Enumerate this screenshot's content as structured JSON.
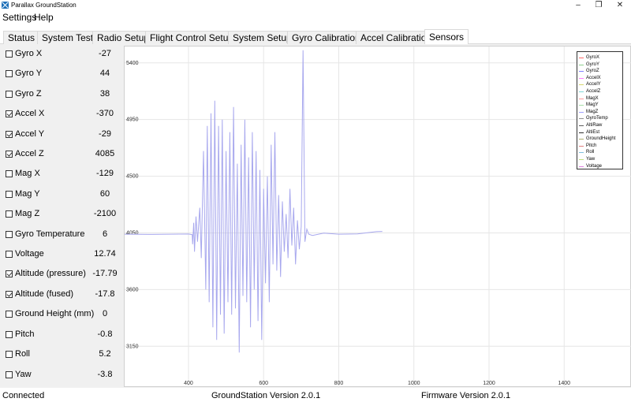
{
  "window": {
    "title": "Parallax GroundStation",
    "minimize": "–",
    "maximize": "❐",
    "close": "✕"
  },
  "menu": {
    "items": [
      "Settings",
      "Help"
    ]
  },
  "tabs": [
    {
      "label": "Status",
      "active": false
    },
    {
      "label": "System Test",
      "active": false
    },
    {
      "label": "Radio Setup",
      "active": false
    },
    {
      "label": "Flight Control Setup",
      "active": false
    },
    {
      "label": "System Setup",
      "active": false
    },
    {
      "label": "Gyro Calibration",
      "active": false
    },
    {
      "label": "Accel Calibration",
      "active": false
    },
    {
      "label": "Sensors",
      "active": true
    }
  ],
  "sensors": [
    {
      "label": "Gyro X",
      "value": "-27",
      "checked": false
    },
    {
      "label": "Gyro Y",
      "value": "44",
      "checked": false
    },
    {
      "label": "Gyro Z",
      "value": "38",
      "checked": false
    },
    {
      "label": "Accel X",
      "value": "-370",
      "checked": true
    },
    {
      "label": "Accel Y",
      "value": "-29",
      "checked": true
    },
    {
      "label": "Accel Z",
      "value": "4085",
      "checked": true
    },
    {
      "label": "Mag X",
      "value": "-129",
      "checked": false
    },
    {
      "label": "Mag Y",
      "value": "60",
      "checked": false
    },
    {
      "label": "Mag Z",
      "value": "-2100",
      "checked": false
    },
    {
      "label": "Gyro Temperature",
      "value": "6",
      "checked": false
    },
    {
      "label": "Voltage",
      "value": "12.74",
      "checked": false
    },
    {
      "label": "Altitude (pressure)",
      "value": "-17.79",
      "checked": true
    },
    {
      "label": "Altitude (fused)",
      "value": "-17.8",
      "checked": true
    },
    {
      "label": "Ground Height (mm)",
      "value": "0",
      "checked": false
    },
    {
      "label": "Pitch",
      "value": "-0.8",
      "checked": false
    },
    {
      "label": "Roll",
      "value": "5.2",
      "checked": false
    },
    {
      "label": "Yaw",
      "value": "-3.8",
      "checked": false
    }
  ],
  "chart_data": {
    "type": "line",
    "grid": true,
    "legend_position": "top-right",
    "x_ticks": [
      400,
      600,
      800,
      1000,
      1200,
      1400
    ],
    "y_ticks": [
      3150,
      3600,
      4050,
      4500,
      4950,
      5400
    ],
    "xlim": [
      230,
      1580
    ],
    "ylim": [
      2820,
      5530
    ],
    "legend": [
      {
        "name": "GyroX",
        "color": "#ff6b6b"
      },
      {
        "name": "GyroY",
        "color": "#8fd18f"
      },
      {
        "name": "GyroZ",
        "color": "#8080ff"
      },
      {
        "name": "AccelX",
        "color": "#ff80ff"
      },
      {
        "name": "AccelY",
        "color": "#d8d870"
      },
      {
        "name": "AccelZ",
        "color": "#80d8d8"
      },
      {
        "name": "MagX",
        "color": "#ff9a9a"
      },
      {
        "name": "MagY",
        "color": "#a8e0a8"
      },
      {
        "name": "MagZ",
        "color": "#a0a0ff"
      },
      {
        "name": "GyroTemp",
        "color": "#909090"
      },
      {
        "name": "AltiRaw",
        "color": "#606060"
      },
      {
        "name": "AltiEst",
        "color": "#303030"
      },
      {
        "name": "GroundHeight",
        "color": "#b0b070"
      },
      {
        "name": "Pitch",
        "color": "#e08080"
      },
      {
        "name": "Roll",
        "color": "#80c0e0"
      },
      {
        "name": "Yaw",
        "color": "#c0e080"
      },
      {
        "name": "Voltage",
        "color": "#e080e0"
      }
    ],
    "series": [
      {
        "color": "#a8a8ee",
        "x": [
          230,
          300,
          400,
          410,
          411,
          414,
          416,
          420,
          424,
          430,
          434,
          440,
          446,
          450,
          455,
          460,
          465,
          470,
          475,
          480,
          485,
          490,
          495,
          500,
          505,
          510,
          515,
          520,
          525,
          530,
          535,
          540,
          545,
          550,
          555,
          560,
          565,
          570,
          575,
          580,
          585,
          590,
          595,
          600,
          605,
          610,
          615,
          620,
          625,
          630,
          635,
          640,
          645,
          650,
          655,
          660,
          665,
          670,
          675,
          680,
          685,
          690,
          695,
          700,
          705,
          710,
          715,
          720,
          730,
          760,
          800,
          850,
          900,
          916
        ],
        "y": [
          4040,
          4038,
          4041,
          4036,
          3960,
          4130,
          3900,
          4180,
          3980,
          4250,
          3850,
          4700,
          3600,
          4900,
          3500,
          5000,
          3300,
          5100,
          3200,
          4900,
          3400,
          4950,
          3250,
          4700,
          3500,
          4850,
          3400,
          5050,
          3450,
          4600,
          3100,
          4750,
          3550,
          4950,
          3500,
          4650,
          3300,
          4850,
          3600,
          4700,
          3350,
          4550,
          3200,
          4400,
          3650,
          4500,
          3500,
          4750,
          3800,
          4850,
          3750,
          4350,
          3700,
          4300,
          3900,
          4200,
          3850,
          4400,
          3950,
          4250,
          3800,
          4150,
          3920,
          4100,
          5500,
          3980,
          4080,
          4040,
          4030,
          4048,
          4040,
          4042,
          4060,
          4062
        ]
      }
    ]
  },
  "status": {
    "connection": "Connected",
    "groundstation_version": "GroundStation Version 2.0.1",
    "firmware_version": "Firmware Version 2.0.1"
  }
}
